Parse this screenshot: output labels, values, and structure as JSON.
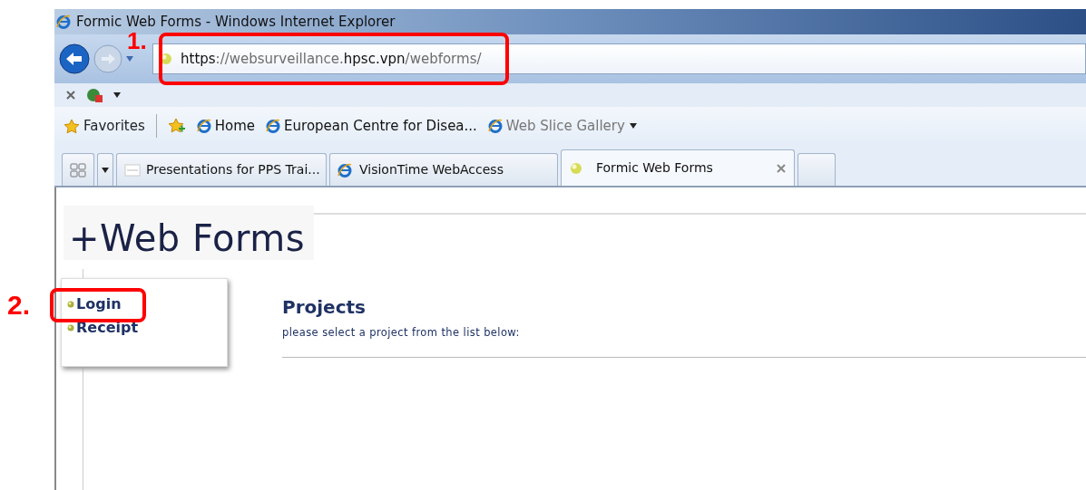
{
  "window": {
    "title": "Formic Web Forms - Windows Internet Explorer"
  },
  "address_bar": {
    "parts": [
      {
        "text": "https",
        "strong": true
      },
      {
        "text": "://websurveillance.",
        "strong": false
      },
      {
        "text": "hpsc.vpn",
        "strong": true
      },
      {
        "text": "/webforms/",
        "strong": false
      }
    ]
  },
  "favorites_bar": {
    "favorites": "Favorites",
    "items": [
      {
        "label": "Home",
        "disabled": false,
        "has_menu": false
      },
      {
        "label": "European Centre for Disea...",
        "disabled": false,
        "has_menu": false
      },
      {
        "label": "Web Slice Gallery",
        "disabled": true,
        "has_menu": true
      }
    ]
  },
  "tabs": [
    {
      "label": "Presentations for PPS Trai...",
      "kind": "site",
      "selected": false
    },
    {
      "label": "VisionTime WebAccess",
      "kind": "ie",
      "selected": false
    },
    {
      "label": "Formic Web Forms",
      "kind": "page",
      "selected": true
    }
  ],
  "page": {
    "logo": "+Web Forms",
    "menu": [
      {
        "label": "Login"
      },
      {
        "label": "Receipt"
      }
    ],
    "heading": "Projects",
    "text": "please select a project from the list below:"
  },
  "annotations": [
    {
      "label": "1."
    },
    {
      "label": "2."
    }
  ]
}
